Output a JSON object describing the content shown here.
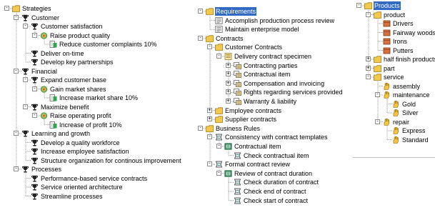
{
  "strategies_tree": [
    {
      "label": "Strategies",
      "icon": "folder-icon",
      "level": 0,
      "toggle": "-"
    },
    {
      "label": "Customer",
      "icon": "trophy-icon",
      "level": 1,
      "toggle": "-"
    },
    {
      "label": "Customer satisfaction",
      "icon": "trophy-icon",
      "level": 2,
      "toggle": "-"
    },
    {
      "label": "Raise product quality",
      "icon": "target-icon",
      "level": 3,
      "toggle": "-"
    },
    {
      "label": "Reduce customer complaints 10%",
      "icon": "measure-icon",
      "level": 4,
      "toggle": ""
    },
    {
      "label": "Deliver on-time",
      "icon": "trophy-icon",
      "level": 2,
      "toggle": ""
    },
    {
      "label": "Develop key partnerships",
      "icon": "trophy-icon",
      "level": 2,
      "toggle": ""
    },
    {
      "label": "Financial",
      "icon": "trophy-icon",
      "level": 1,
      "toggle": "-"
    },
    {
      "label": "Expand customer base",
      "icon": "trophy-icon",
      "level": 2,
      "toggle": "-"
    },
    {
      "label": "Gain market shares",
      "icon": "target-icon",
      "level": 3,
      "toggle": "-"
    },
    {
      "label": "Increase market share 10%",
      "icon": "measure-icon",
      "level": 4,
      "toggle": ""
    },
    {
      "label": "Maximize benefit",
      "icon": "trophy-icon",
      "level": 2,
      "toggle": "-"
    },
    {
      "label": "Raise operating profit",
      "icon": "target-icon",
      "level": 3,
      "toggle": "-"
    },
    {
      "label": "Increase of profit 10%",
      "icon": "measure-icon",
      "level": 4,
      "toggle": ""
    },
    {
      "label": "Learning and growth",
      "icon": "trophy-icon",
      "level": 1,
      "toggle": "-"
    },
    {
      "label": "Develop a quality workforce",
      "icon": "trophy-icon",
      "level": 2,
      "toggle": ""
    },
    {
      "label": "Increase employee satisfaction",
      "icon": "trophy-icon",
      "level": 2,
      "toggle": ""
    },
    {
      "label": "Structure organization for continous improvement",
      "icon": "trophy-icon",
      "level": 2,
      "toggle": ""
    },
    {
      "label": "Processes",
      "icon": "trophy-icon",
      "level": 1,
      "toggle": "-"
    },
    {
      "label": "Performance-based service contracts",
      "icon": "trophy-icon",
      "level": 2,
      "toggle": ""
    },
    {
      "label": "Service oriented architecture",
      "icon": "trophy-icon",
      "level": 2,
      "toggle": ""
    },
    {
      "label": "Streamline processes",
      "icon": "trophy-icon",
      "level": 2,
      "toggle": ""
    }
  ],
  "requirements_tree": [
    {
      "label": "Requirements",
      "icon": "folder-icon",
      "level": 0,
      "toggle": "-",
      "selected": true
    },
    {
      "label": "Accomplish production process review",
      "icon": "document-icon",
      "level": 1,
      "toggle": ""
    },
    {
      "label": "Maintain enterprise model",
      "icon": "document-icon",
      "level": 1,
      "toggle": ""
    },
    {
      "label": "Contracts",
      "icon": "folder-icon",
      "level": 0,
      "toggle": "-"
    },
    {
      "label": "Customer Contracts",
      "icon": "folder-icon",
      "level": 1,
      "toggle": "-"
    },
    {
      "label": "Delivery contract specimen",
      "icon": "contract-icon",
      "level": 2,
      "toggle": "-"
    },
    {
      "label": "Contracting parties",
      "icon": "clause-icon",
      "level": 3,
      "toggle": "+"
    },
    {
      "label": "Contractual item",
      "icon": "clause-icon",
      "level": 3,
      "toggle": "+"
    },
    {
      "label": "Compensation and invoicing",
      "icon": "clause-icon",
      "level": 3,
      "toggle": "+"
    },
    {
      "label": "Rights regarding services provided",
      "icon": "clause-icon",
      "level": 3,
      "toggle": "+"
    },
    {
      "label": "Warranty & liability",
      "icon": "clause-icon",
      "level": 3,
      "toggle": "+"
    },
    {
      "label": "Employee contracts",
      "icon": "folder-icon",
      "level": 1,
      "toggle": "+"
    },
    {
      "label": "Supplier contracts",
      "icon": "folder-icon",
      "level": 1,
      "toggle": "+"
    },
    {
      "label": "Business Rules",
      "icon": "folder-icon",
      "level": 0,
      "toggle": "-"
    },
    {
      "label": "Consistency with contract templates",
      "icon": "rule-icon",
      "level": 1,
      "toggle": "-"
    },
    {
      "label": "Contractual item",
      "icon": "rule-set-icon",
      "level": 2,
      "toggle": "-"
    },
    {
      "label": "Check contractual item",
      "icon": "rule-icon",
      "level": 3,
      "toggle": ""
    },
    {
      "label": "Formal contract review",
      "icon": "rule-icon",
      "level": 1,
      "toggle": "-"
    },
    {
      "label": "Review of contract duration",
      "icon": "rule-set-icon",
      "level": 2,
      "toggle": "-"
    },
    {
      "label": "Check duration of contract",
      "icon": "rule-icon",
      "level": 3,
      "toggle": ""
    },
    {
      "label": "Check end of contract",
      "icon": "rule-icon",
      "level": 3,
      "toggle": ""
    },
    {
      "label": "Check start of contract",
      "icon": "rule-icon",
      "level": 3,
      "toggle": ""
    }
  ],
  "products_tree": [
    {
      "label": "Products",
      "icon": "folder-icon",
      "level": 0,
      "toggle": "-",
      "selected": true
    },
    {
      "label": "product",
      "icon": "folder-icon",
      "level": 1,
      "toggle": "-"
    },
    {
      "label": "Drivers",
      "icon": "product-icon",
      "level": 2,
      "toggle": ""
    },
    {
      "label": "Fairway woods",
      "icon": "product-icon",
      "level": 2,
      "toggle": ""
    },
    {
      "label": "Irons",
      "icon": "product-icon",
      "level": 2,
      "toggle": ""
    },
    {
      "label": "Putters",
      "icon": "product-icon",
      "level": 2,
      "toggle": ""
    },
    {
      "label": "half finish products",
      "icon": "folder-icon",
      "level": 1,
      "toggle": "+"
    },
    {
      "label": "part",
      "icon": "folder-icon",
      "level": 1,
      "toggle": "+"
    },
    {
      "label": "service",
      "icon": "folder-icon",
      "level": 1,
      "toggle": "-"
    },
    {
      "label": "assembly",
      "icon": "service-hand-icon",
      "level": 2,
      "toggle": ""
    },
    {
      "label": "maintenance",
      "icon": "service-hand-icon",
      "level": 2,
      "toggle": "-"
    },
    {
      "label": "Gold",
      "icon": "service-hand-icon",
      "level": 3,
      "toggle": ""
    },
    {
      "label": "Silver",
      "icon": "service-hand-icon",
      "level": 3,
      "toggle": ""
    },
    {
      "label": "repair",
      "icon": "service-hand-icon",
      "level": 2,
      "toggle": "-"
    },
    {
      "label": "Express",
      "icon": "service-hand-icon",
      "level": 3,
      "toggle": ""
    },
    {
      "label": "Standard",
      "icon": "service-hand-icon",
      "level": 3,
      "toggle": ""
    }
  ],
  "colors": {
    "selection": "#316ac5",
    "folder": "#f2c94c",
    "tree_line": "#9a9a9a"
  }
}
